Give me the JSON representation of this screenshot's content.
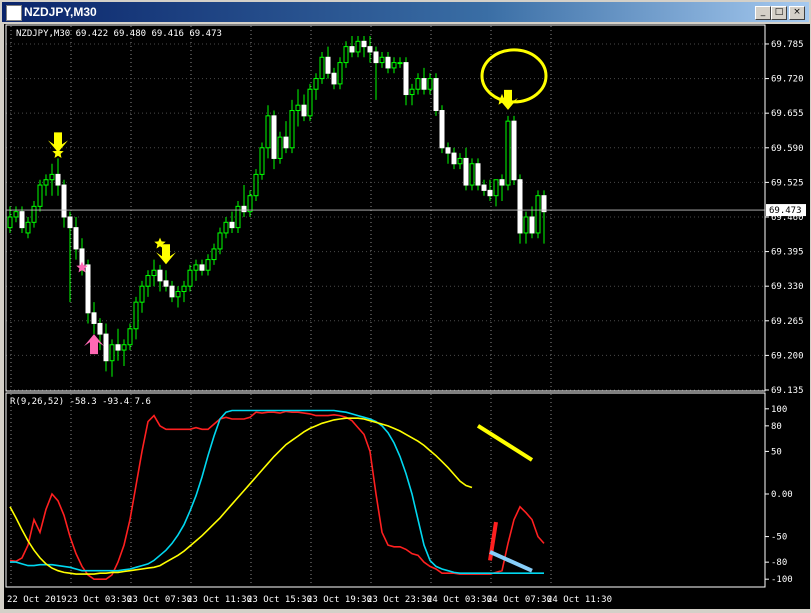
{
  "window": {
    "title": "NZDJPY,M30",
    "buttons": [
      "_",
      "□",
      "×"
    ]
  },
  "chart_data": [
    {
      "type": "candlestick",
      "header": "NZDJPY,M30  69.422 69.480 69.416 69.473",
      "price_label": "69.473",
      "current_price": 69.473,
      "ylim": [
        69.135,
        69.815
      ],
      "y_ticks": [
        "69.785",
        "69.720",
        "69.655",
        "69.590",
        "69.525",
        "69.460",
        "69.395",
        "69.330",
        "69.265",
        "69.200",
        "69.135"
      ],
      "y_tick_values": [
        69.785,
        69.72,
        69.655,
        69.59,
        69.525,
        69.46,
        69.395,
        69.33,
        69.265,
        69.2,
        69.135
      ],
      "candles": [
        [
          69.44,
          69.48,
          69.43,
          69.46
        ],
        [
          69.46,
          69.48,
          69.45,
          69.47
        ],
        [
          69.47,
          69.48,
          69.43,
          69.44
        ],
        [
          69.43,
          69.46,
          69.42,
          69.45
        ],
        [
          69.45,
          69.49,
          69.44,
          69.48
        ],
        [
          69.48,
          69.53,
          69.47,
          69.52
        ],
        [
          69.52,
          69.54,
          69.5,
          69.53
        ],
        [
          69.53,
          69.56,
          69.5,
          69.54
        ],
        [
          69.54,
          69.57,
          69.5,
          69.52
        ],
        [
          69.52,
          69.53,
          69.44,
          69.46
        ],
        [
          69.46,
          69.47,
          69.3,
          69.44
        ],
        [
          69.44,
          69.46,
          69.38,
          69.4
        ],
        [
          69.4,
          69.42,
          69.35,
          69.37
        ],
        [
          69.37,
          69.38,
          69.26,
          69.28
        ],
        [
          69.28,
          69.3,
          69.24,
          69.26
        ],
        [
          69.26,
          69.27,
          69.21,
          69.24
        ],
        [
          69.24,
          69.26,
          69.17,
          69.19
        ],
        [
          69.19,
          69.23,
          69.16,
          69.22
        ],
        [
          69.22,
          69.25,
          69.19,
          69.21
        ],
        [
          69.21,
          69.23,
          69.18,
          69.22
        ],
        [
          69.22,
          69.26,
          69.21,
          69.25
        ],
        [
          69.25,
          69.31,
          69.23,
          69.3
        ],
        [
          69.3,
          69.34,
          69.28,
          69.33
        ],
        [
          69.33,
          69.36,
          69.31,
          69.35
        ],
        [
          69.35,
          69.38,
          69.33,
          69.36
        ],
        [
          69.36,
          69.37,
          69.32,
          69.34
        ],
        [
          69.34,
          69.36,
          69.32,
          69.33
        ],
        [
          69.33,
          69.34,
          69.3,
          69.31
        ],
        [
          69.31,
          69.33,
          69.29,
          69.32
        ],
        [
          69.32,
          69.34,
          69.3,
          69.33
        ],
        [
          69.33,
          69.37,
          69.32,
          69.36
        ],
        [
          69.36,
          69.38,
          69.34,
          69.37
        ],
        [
          69.37,
          69.38,
          69.35,
          69.36
        ],
        [
          69.36,
          69.39,
          69.35,
          69.38
        ],
        [
          69.38,
          69.41,
          69.37,
          69.4
        ],
        [
          69.4,
          69.44,
          69.39,
          69.43
        ],
        [
          69.43,
          69.46,
          69.42,
          69.45
        ],
        [
          69.45,
          69.47,
          69.43,
          69.44
        ],
        [
          69.44,
          69.49,
          69.43,
          69.48
        ],
        [
          69.48,
          69.52,
          69.46,
          69.47
        ],
        [
          69.47,
          69.51,
          69.46,
          69.5
        ],
        [
          69.5,
          69.55,
          69.49,
          69.54
        ],
        [
          69.54,
          69.6,
          69.53,
          69.59
        ],
        [
          69.59,
          69.67,
          69.57,
          69.65
        ],
        [
          69.65,
          69.66,
          69.55,
          69.57
        ],
        [
          69.57,
          69.62,
          69.56,
          69.61
        ],
        [
          69.61,
          69.64,
          69.58,
          69.59
        ],
        [
          69.59,
          69.68,
          69.58,
          69.66
        ],
        [
          69.66,
          69.7,
          69.63,
          69.67
        ],
        [
          69.67,
          69.69,
          69.64,
          69.65
        ],
        [
          69.65,
          69.71,
          69.64,
          69.7
        ],
        [
          69.7,
          69.73,
          69.68,
          69.72
        ],
        [
          69.72,
          69.77,
          69.71,
          69.76
        ],
        [
          69.76,
          69.78,
          69.72,
          69.73
        ],
        [
          69.73,
          69.74,
          69.7,
          69.71
        ],
        [
          69.71,
          69.76,
          69.7,
          69.75
        ],
        [
          69.75,
          69.79,
          69.74,
          69.78
        ],
        [
          69.78,
          69.8,
          69.76,
          69.77
        ],
        [
          69.77,
          69.8,
          69.76,
          69.79
        ],
        [
          69.79,
          69.8,
          69.76,
          69.78
        ],
        [
          69.78,
          69.8,
          69.75,
          69.77
        ],
        [
          69.77,
          69.78,
          69.68,
          69.75
        ],
        [
          69.75,
          69.77,
          69.74,
          69.76
        ],
        [
          69.76,
          69.77,
          69.73,
          69.74
        ],
        [
          69.74,
          69.76,
          69.73,
          69.75
        ],
        [
          69.75,
          69.76,
          69.74,
          69.75
        ],
        [
          69.75,
          69.76,
          69.67,
          69.69
        ],
        [
          69.69,
          69.71,
          69.67,
          69.7
        ],
        [
          69.7,
          69.73,
          69.69,
          69.72
        ],
        [
          69.72,
          69.74,
          69.69,
          69.7
        ],
        [
          69.7,
          69.73,
          69.69,
          69.72
        ],
        [
          69.72,
          69.73,
          69.65,
          69.66
        ],
        [
          69.66,
          69.67,
          69.58,
          69.59
        ],
        [
          69.59,
          69.6,
          69.56,
          69.58
        ],
        [
          69.58,
          69.59,
          69.55,
          69.56
        ],
        [
          69.56,
          69.58,
          69.55,
          69.57
        ],
        [
          69.57,
          69.59,
          69.51,
          69.52
        ],
        [
          69.52,
          69.57,
          69.51,
          69.56
        ],
        [
          69.56,
          69.57,
          69.51,
          69.52
        ],
        [
          69.52,
          69.53,
          69.5,
          69.51
        ],
        [
          69.51,
          69.53,
          69.49,
          69.5
        ],
        [
          69.5,
          69.53,
          69.48,
          69.53
        ],
        [
          69.53,
          69.54,
          69.49,
          69.52
        ],
        [
          69.52,
          69.65,
          69.51,
          69.64
        ],
        [
          69.64,
          69.65,
          69.52,
          69.53
        ],
        [
          69.53,
          69.54,
          69.41,
          69.43
        ],
        [
          69.43,
          69.47,
          69.41,
          69.46
        ],
        [
          69.46,
          69.48,
          69.42,
          69.43
        ],
        [
          69.43,
          69.51,
          69.42,
          69.5
        ],
        [
          69.5,
          69.51,
          69.41,
          69.47
        ]
      ],
      "signals": [
        {
          "index": 8,
          "kind": "sell-arrow",
          "color": "#ffff00"
        },
        {
          "index": 8,
          "kind": "star",
          "color": "#ffff00",
          "price": 69.58
        },
        {
          "index": 12,
          "kind": "star",
          "color": "#ff69b4",
          "price": 69.365
        },
        {
          "index": 14,
          "kind": "buy-arrow",
          "color": "#ff69b4"
        },
        {
          "index": 26,
          "kind": "sell-arrow",
          "color": "#ffff00"
        },
        {
          "index": 25,
          "kind": "star",
          "color": "#ffff00",
          "price": 69.41
        },
        {
          "index": 83,
          "kind": "sell-arrow",
          "color": "#ffff00"
        },
        {
          "index": 82,
          "kind": "star",
          "color": "#ffff00",
          "price": 69.68
        }
      ],
      "circle_marker": {
        "index": 84,
        "price": 69.725,
        "color": "#ffff00"
      }
    },
    {
      "type": "line",
      "header": "R(9,26,52) -58.3 -93.4 7.6",
      "ylim": [
        -108,
        108
      ],
      "y_ticks": [
        "100",
        "80",
        "50",
        "0.00",
        "-50",
        "-80",
        "-100"
      ],
      "y_tick_values": [
        100,
        80,
        50,
        0,
        -50,
        -80,
        -100
      ],
      "x_tick_labels": [
        "22 Oct 2019",
        "23 Oct 03:30",
        "23 Oct 07:30",
        "23 Oct 11:30",
        "23 Oct 15:30",
        "23 Oct 19:30",
        "23 Oct 23:30",
        "24 Oct 03:30",
        "24 Oct 07:30",
        "24 Oct 11:30"
      ],
      "x_tick_index": [
        0,
        10,
        20,
        30,
        40,
        50,
        60,
        70,
        80,
        90
      ],
      "series": [
        {
          "color": "#ff2020",
          "values": [
            -78,
            -79,
            -75,
            -60,
            -30,
            -45,
            -18,
            0,
            -8,
            -25,
            -50,
            -70,
            -85,
            -95,
            -100,
            -100,
            -100,
            -95,
            -80,
            -60,
            -30,
            10,
            50,
            85,
            92,
            80,
            76,
            76,
            76,
            76,
            76,
            78,
            76,
            76,
            82,
            88,
            90,
            88,
            88,
            88,
            90,
            96,
            95,
            96,
            96,
            95,
            97,
            96,
            96,
            95,
            94,
            92,
            92,
            92,
            93,
            92,
            90,
            86,
            78,
            70,
            50,
            0,
            -45,
            -60,
            -62,
            -62,
            -65,
            -70,
            -72,
            -80,
            -85,
            -88,
            -93,
            -93,
            -93,
            -94,
            -94,
            -94,
            -94,
            -94,
            -94,
            -92,
            -90,
            -58,
            -30,
            -15,
            -22,
            -30,
            -50,
            -58
          ]
        },
        {
          "color": "#00d8f0",
          "values": [
            -80,
            -80,
            -82,
            -84,
            -84,
            -83,
            -83,
            -83,
            -84,
            -85,
            -86,
            -88,
            -90,
            -90,
            -90,
            -90,
            -90,
            -90,
            -90,
            -89,
            -88,
            -86,
            -84,
            -82,
            -78,
            -72,
            -66,
            -58,
            -48,
            -36,
            -20,
            -2,
            20,
            45,
            68,
            88,
            96,
            98,
            98,
            98,
            98,
            98,
            98,
            98,
            98,
            98,
            98,
            98,
            98,
            98,
            98,
            98,
            98,
            98,
            98,
            97,
            96,
            94,
            92,
            90,
            88,
            85,
            80,
            72,
            60,
            44,
            24,
            0,
            -30,
            -60,
            -78,
            -85,
            -88,
            -90,
            -92,
            -93,
            -93,
            -93,
            -93,
            -93,
            -93,
            -93,
            -93,
            -93,
            -93,
            -93,
            -93,
            -93,
            -93,
            -93
          ]
        },
        {
          "color": "#ffff00",
          "values": [
            -15,
            -28,
            -42,
            -55,
            -66,
            -75,
            -82,
            -87,
            -90,
            -92,
            -93,
            -94,
            -94,
            -94,
            -94,
            -93,
            -93,
            -92,
            -92,
            -91,
            -90,
            -89,
            -88,
            -87,
            -86,
            -84,
            -80,
            -76,
            -72,
            -67,
            -61,
            -55,
            -49,
            -42,
            -35,
            -28,
            -20,
            -12,
            -4,
            4,
            12,
            20,
            28,
            36,
            44,
            51,
            58,
            63,
            68,
            73,
            77,
            80,
            83,
            85,
            87,
            88,
            89,
            89,
            89,
            88,
            86,
            84,
            82,
            80,
            77,
            74,
            70,
            66,
            62,
            57,
            51,
            45,
            38,
            31,
            23,
            15,
            10,
            7.6
          ]
        }
      ],
      "annotations": [
        {
          "kind": "line",
          "color": "#ffff00",
          "from": [
            78,
            80
          ],
          "to": [
            87,
            40
          ]
        },
        {
          "kind": "line",
          "color": "#ff2020",
          "from": [
            80,
            -78
          ],
          "to": [
            81,
            -33
          ]
        },
        {
          "kind": "line",
          "color": "#87cefa",
          "from": [
            80,
            -68
          ],
          "to": [
            87,
            -90
          ]
        }
      ]
    }
  ]
}
